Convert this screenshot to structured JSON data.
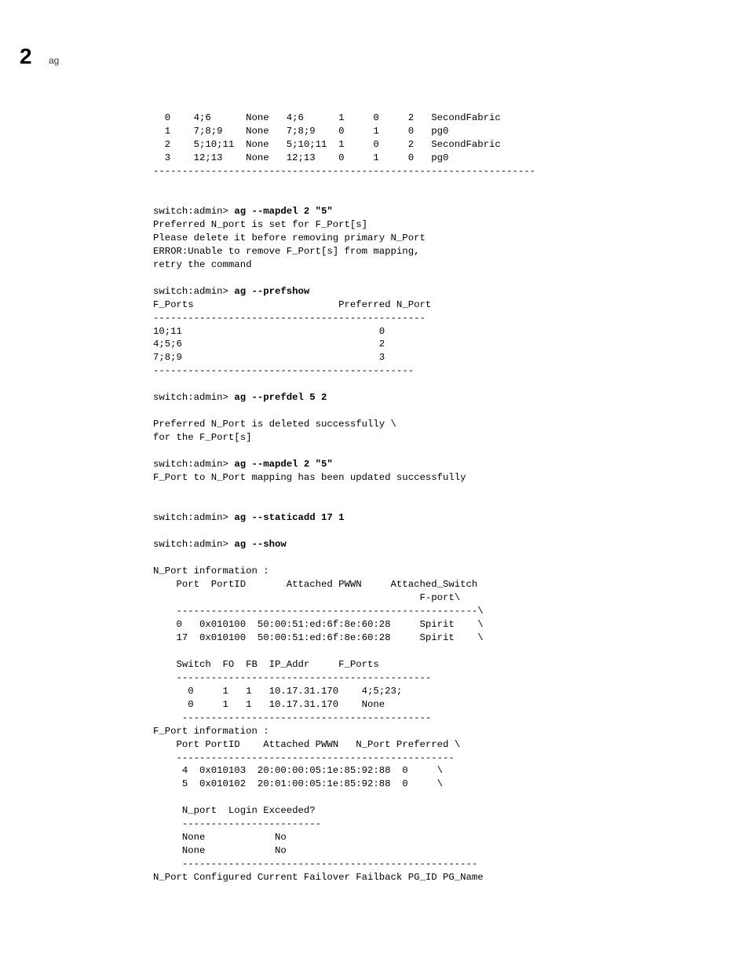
{
  "header": {
    "page_num": "2",
    "tag": "ag"
  },
  "table_top": {
    "row0": "  0    4;6      None   4;6      1     0     2   SecondFabric",
    "row1": "  1    7;8;9    None   7;8;9    0     1     0   pg0",
    "row2": "  2    5;10;11  None   5;10;11  1     0     2   SecondFabric",
    "row3": "  3    12;13    None   12;13    0     1     0   pg0",
    "sep": "------------------------------------------------------------------"
  },
  "block1": {
    "prompt": "switch:admin> ",
    "cmd": "ag --mapdel 2 \"5\"",
    "l1": "Preferred N_port is set for F_Port[s]",
    "l2": "Please delete it before removing primary N_Port",
    "l3": "ERROR:Unable to remove F_Port[s] from mapping,",
    "l4": "retry the command"
  },
  "block2": {
    "prompt": "switch:admin> ",
    "cmd": "ag --prefshow",
    "hdr": "F_Ports                         Preferred N_Port",
    "sep1": "-----------------------------------------------",
    "r1": "10;11                                  0",
    "r2": "4;5;6                                  2",
    "r3": "7;8;9                                  3",
    "sep2": "---------------------------------------------"
  },
  "block3": {
    "prompt": "switch:admin> ",
    "cmd": "ag --prefdel 5 2",
    "l1": "Preferred N_Port is deleted successfully \\",
    "l2": "for the F_Port[s]"
  },
  "block4": {
    "prompt": "switch:admin> ",
    "cmd": "ag --mapdel 2 \"5\"",
    "l1": "F_Port to N_Port mapping has been updated successfully"
  },
  "block5": {
    "prompt": "switch:admin> ",
    "cmd": "ag --staticadd 17 1"
  },
  "block6": {
    "prompt": "switch:admin> ",
    "cmd": "ag --show"
  },
  "nport": {
    "title": "N_Port information :",
    "hdr1": "    Port  PortID       Attached PWWN     Attached_Switch",
    "hdr2": "                                              F-port\\",
    "sep1": "    ----------------------------------------------------\\",
    "r1": "    0   0x010100  50:00:51:ed:6f:8e:60:28     Spirit    \\",
    "r2": "    17  0x010100  50:00:51:ed:6f:8e:60:28     Spirit    \\",
    "hdr3": "    Switch  FO  FB  IP_Addr     F_Ports",
    "sep2": "    --------------------------------------------",
    "r3": "      0     1   1   10.17.31.170    4;5;23;",
    "r4": "      0     1   1   10.17.31.170    None",
    "sep3": "     -------------------------------------------"
  },
  "fport": {
    "title": "F_Port information :",
    "hdr": "    Port PortID    Attached PWWN   N_Port Preferred \\",
    "sep1": "    ------------------------------------------------",
    "r1": "     4  0x010103  20:00:00:05:1e:85:92:88  0     \\",
    "r2": "     5  0x010102  20:01:00:05:1e:85:92:88  0     \\",
    "hdr2": "     N_port  Login Exceeded?",
    "sep2": "     ------------------------",
    "r3": "     None            No",
    "r4": "     None            No",
    "sep3": "     ---------------------------------------------------"
  },
  "footer_line": "N_Port Configured Current Failover Failback PG_ID PG_Name"
}
